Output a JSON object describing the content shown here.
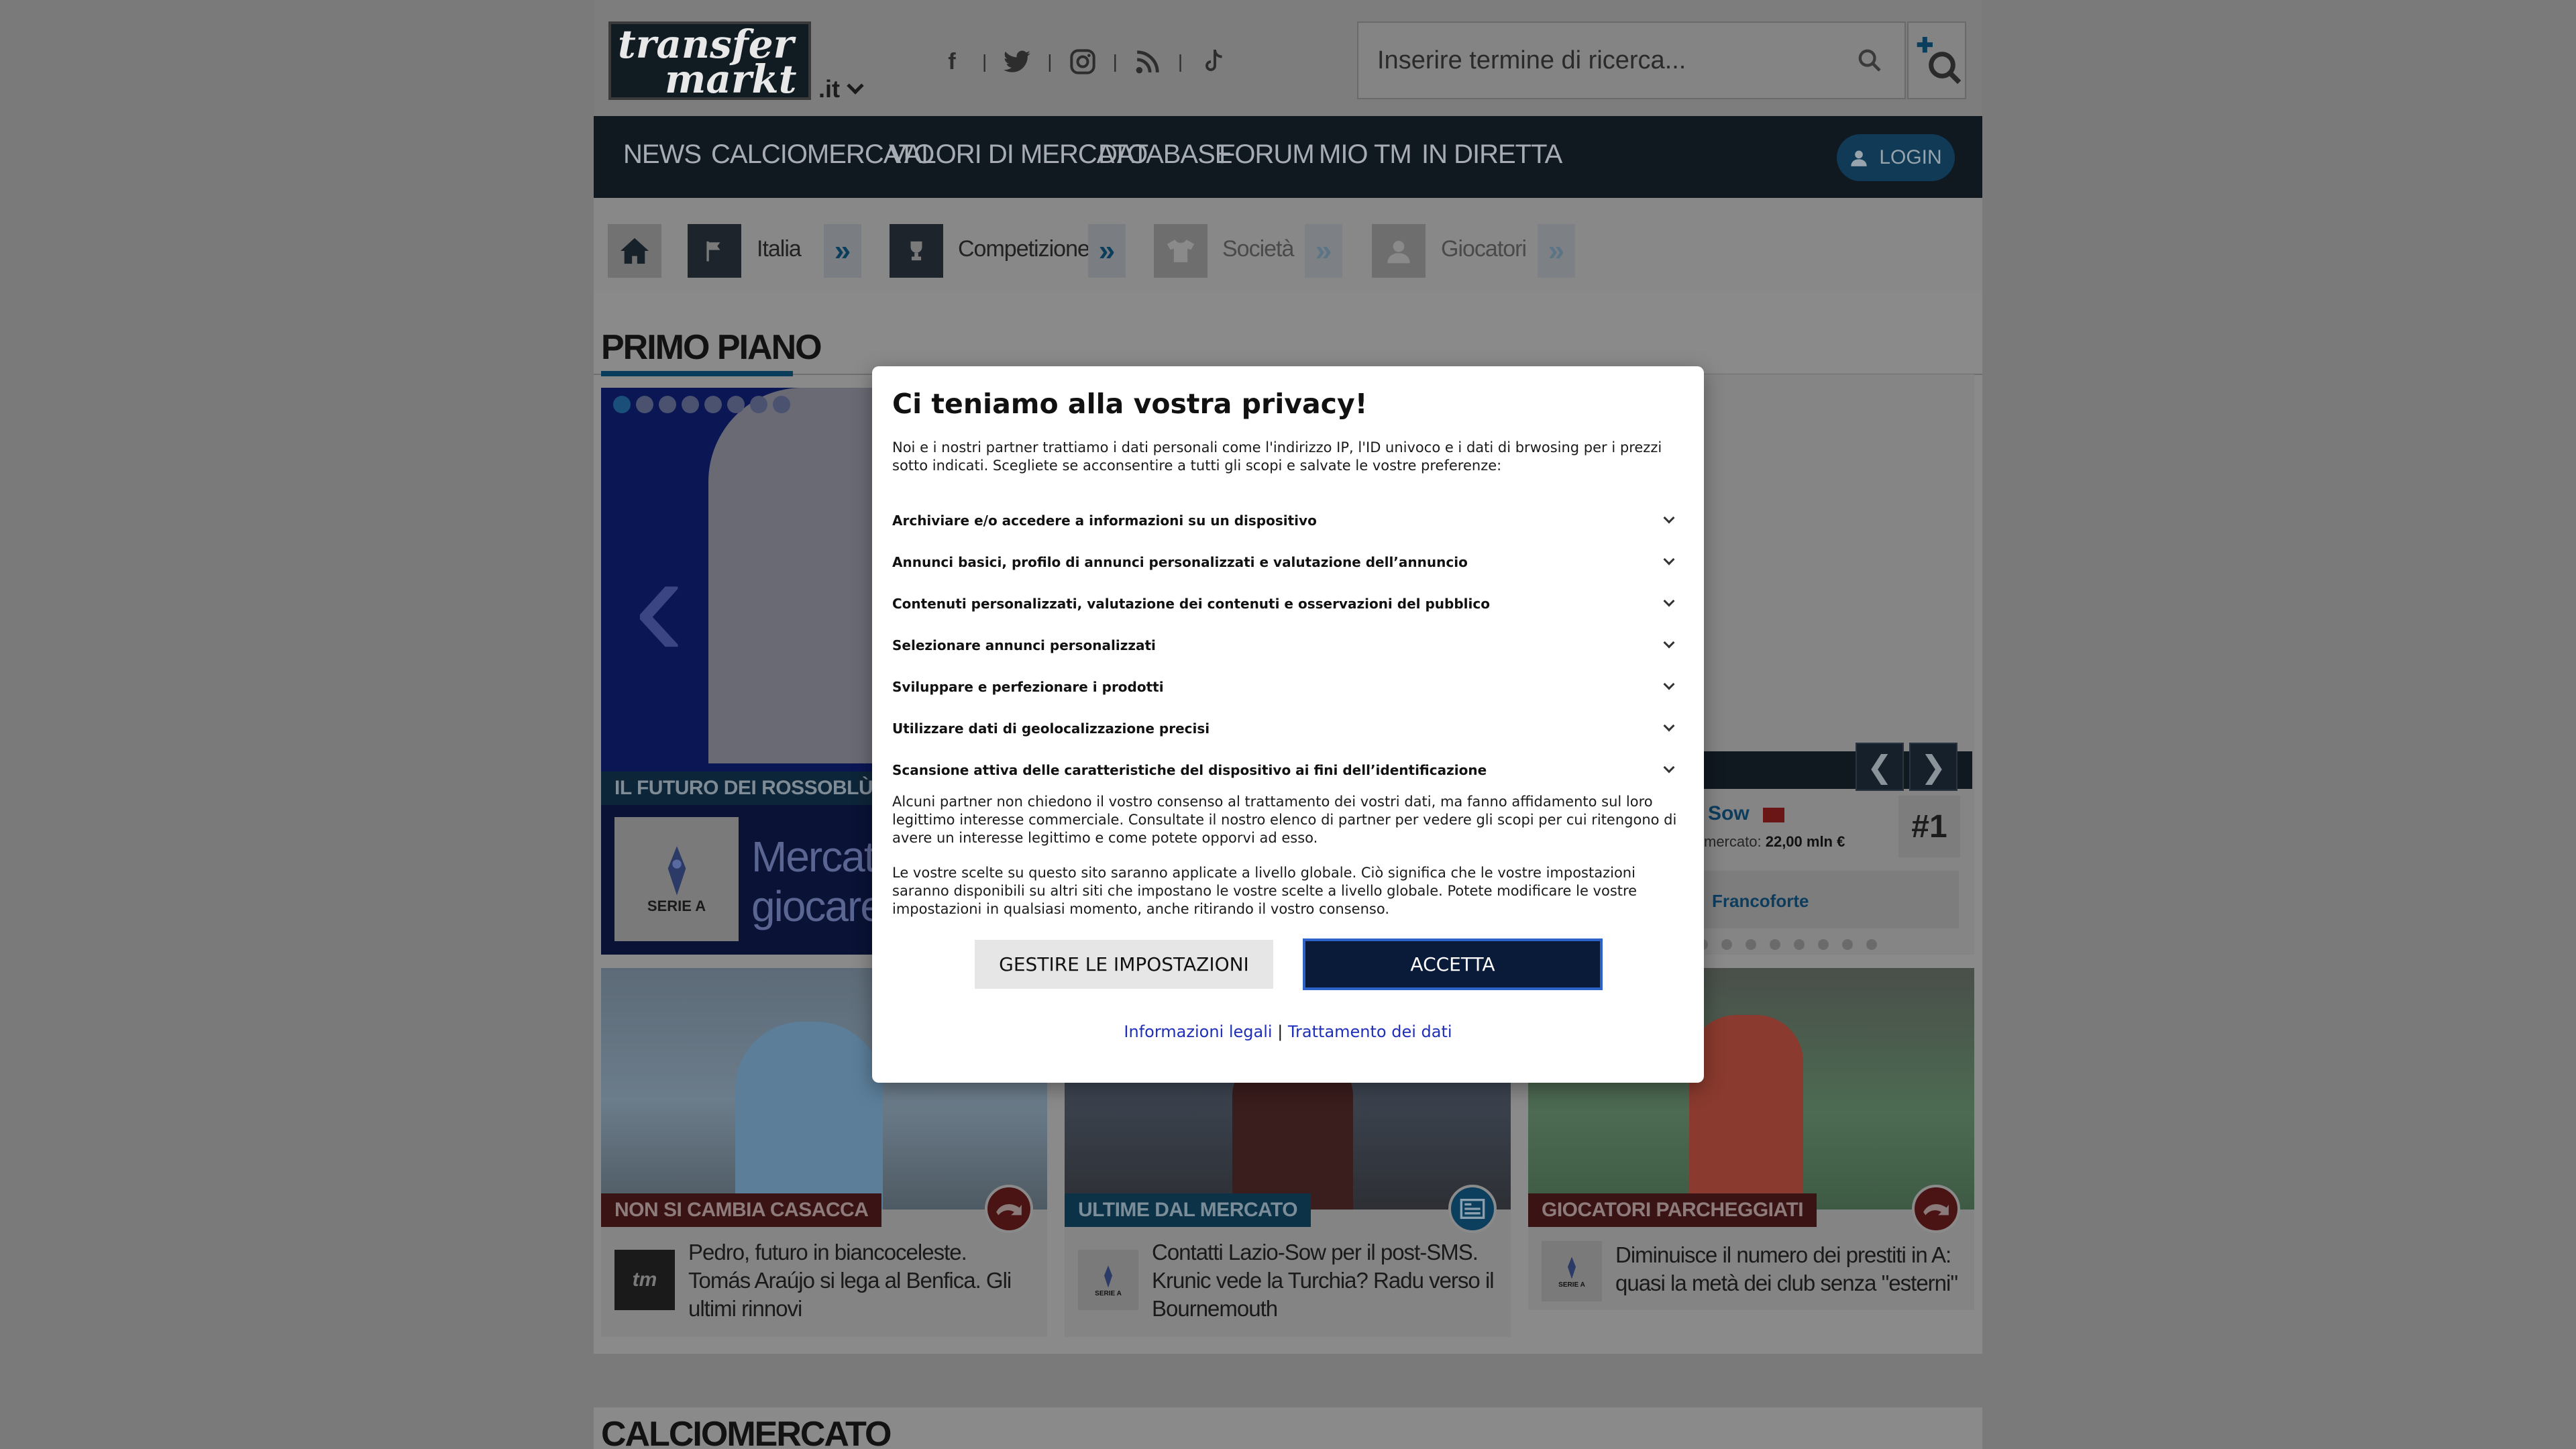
{
  "header": {
    "logo_text_line1": "transfer",
    "logo_text_line2": "markt",
    "domain_label": ".it",
    "social_icons": [
      "facebook-icon",
      "twitter-icon",
      "instagram-icon",
      "rss-icon",
      "tiktok-icon"
    ],
    "search_placeholder": "Inserire termine di ricerca..."
  },
  "nav": {
    "items": [
      "NEWS",
      "CALCIOMERCATO",
      "VALORI DI MERCATO",
      "DATABASE",
      "FORUM",
      "MIO TM",
      "IN DIRETTA"
    ],
    "login_label": "LOGIN"
  },
  "breadcrumb": {
    "country": "Italia",
    "competition": "Competizione",
    "club": "Società",
    "players": "Giocatori"
  },
  "main": {
    "section_title": "PRIMO PIANO",
    "hero": {
      "tag": "IL FUTURO DEI ROSSOBLÙ",
      "logo_label": "SERIE A",
      "headline_line1": "Mercato",
      "headline_line2": "giocare."
    },
    "ranking_panel": {
      "player_name": "Sow",
      "market_value_label": "mercato:",
      "market_value": "22,00 mln €",
      "rank": "#1",
      "club": "Francoforte",
      "prev_symbol": "❮",
      "next_symbol": "❯"
    },
    "cards": [
      {
        "tag": "NON SI CAMBIA CASACCA",
        "icon_label": "tm",
        "text": "Pedro, futuro in biancoceleste. Tomás Araújo si lega al Benfica. Gli ultimi rinnovi"
      },
      {
        "tag": "ULTIME DAL MERCATO",
        "icon_label": "SERIE A",
        "text": "Contatti Lazio-Sow per il post-SMS. Krunic vede la Turchia? Radu verso il Bournemouth"
      },
      {
        "tag": "GIOCATORI PARCHEGGIATI",
        "icon_label": "SERIE A",
        "text": "Diminuisce il numero dei prestiti in A: quasi la metà dei club senza \"esterni\""
      }
    ],
    "section2_title": "CALCIOMERCATO"
  },
  "consent": {
    "title": "Ci teniamo alla vostra privacy!",
    "intro": "Noi e i nostri partner trattiamo i dati personali come l'indirizzo IP, l'ID univoco e i dati di brwosing per i prezzi sotto indicati. Scegliete se acconsentire a tutti gli scopi e salvate le vostre preferenze:",
    "purposes": [
      "Archiviare e/o accedere a informazioni su un dispositivo",
      "Annunci basici, profilo di annunci personalizzati e valutazione dell’annuncio",
      "Contenuti personalizzati, valutazione dei contenuti e osservazioni del pubblico",
      "Selezionare annunci personalizzati",
      "Sviluppare e perfezionare i prodotti",
      "Utilizzare dati di geolocalizzazione precisi",
      "Scansione attiva delle caratteristiche del dispositivo ai fini dell’identificazione"
    ],
    "legit_interest_text": "Alcuni partner non chiedono il vostro consenso al trattamento dei vostri dati, ma fanno affidamento sul loro legittimo interesse commerciale. Consultate il nostro elenco di partner per vedere gli scopi per cui ritengono di avere un interesse legittimo e come potete opporvi ad esso.",
    "global_text": "Le vostre scelte su questo sito saranno applicate a livello globale. Ciò significa che le vostre impostazioni saranno disponibili su altri siti che impostano le vostre scelte a livello globale. Potete modificare le vostre impostazioni in qualsiasi momento, anche ritirando il vostro consenso.",
    "manage_button": "GESTIRE LE IMPOSTAZIONI",
    "accept_button": "ACCETTA",
    "link_legal": "Informazioni legali",
    "link_separator": "|",
    "link_data": "Trattamento dei dati"
  }
}
